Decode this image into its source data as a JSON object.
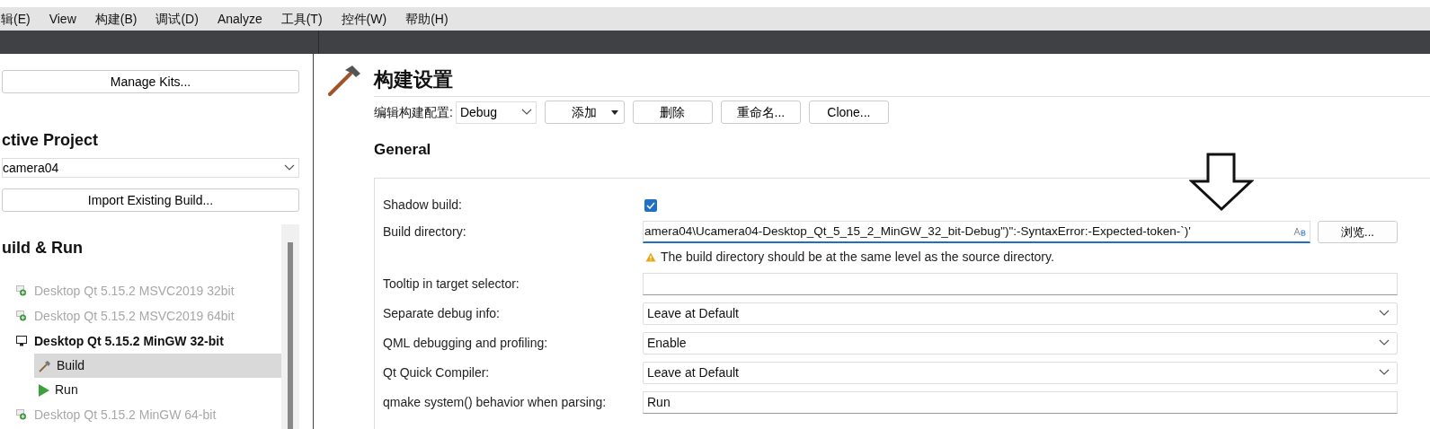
{
  "menu": [
    "辑(E)",
    "View",
    "构建(B)",
    "调试(D)",
    "Analyze",
    "工具(T)",
    "控件(W)",
    "帮助(H)"
  ],
  "sidebar": {
    "manage_kits": "Manage Kits...",
    "active_project_heading": "ctive Project",
    "project": "camera04",
    "import_button": "Import Existing Build...",
    "build_run_heading": "uild & Run",
    "kits": [
      {
        "label": "Desktop Qt 5.15.2 MSVC2019 32bit",
        "enabled": false
      },
      {
        "label": "Desktop Qt 5.15.2 MSVC2019 64bit",
        "enabled": false
      },
      {
        "label": "Desktop Qt 5.15.2 MinGW 32-bit",
        "enabled": true,
        "children": [
          {
            "label": "Build",
            "kind": "build",
            "selected": true
          },
          {
            "label": "Run",
            "kind": "run",
            "selected": false
          }
        ]
      },
      {
        "label": "Desktop Qt 5.15.2 MinGW 64-bit",
        "enabled": false
      }
    ]
  },
  "page": {
    "title": "构建设置",
    "config_label": "编辑构建配置:",
    "config": "Debug",
    "buttons": [
      {
        "label": "添加",
        "kind": "menu"
      },
      {
        "label": "删除",
        "kind": "plain"
      },
      {
        "label": "重命名...",
        "kind": "plain"
      },
      {
        "label": "Clone...",
        "kind": "plain"
      }
    ],
    "section": "General",
    "rows": [
      {
        "kind": "checkbox",
        "label": "Shadow build:",
        "checked": true
      },
      {
        "kind": "path",
        "label": "Build directory:",
        "value": "amera04\\Ucamera04-Desktop_Qt_5_15_2_MinGW_32_bit-Debug\")\":-SyntaxError:-Expected-token-`)'",
        "button": "浏览...",
        "warning": "The build directory should be at the same level as the source directory."
      },
      {
        "kind": "text",
        "label": "Tooltip in target selector:"
      },
      {
        "kind": "combo",
        "label": "Separate debug info:",
        "value": "Leave at Default"
      },
      {
        "kind": "combo",
        "label": "QML debugging and profiling:",
        "value": "Enable"
      },
      {
        "kind": "combo",
        "label": "Qt Quick Compiler:",
        "value": "Leave at Default"
      },
      {
        "kind": "text",
        "label": "qmake system() behavior when parsing:",
        "value": "Run"
      }
    ]
  }
}
